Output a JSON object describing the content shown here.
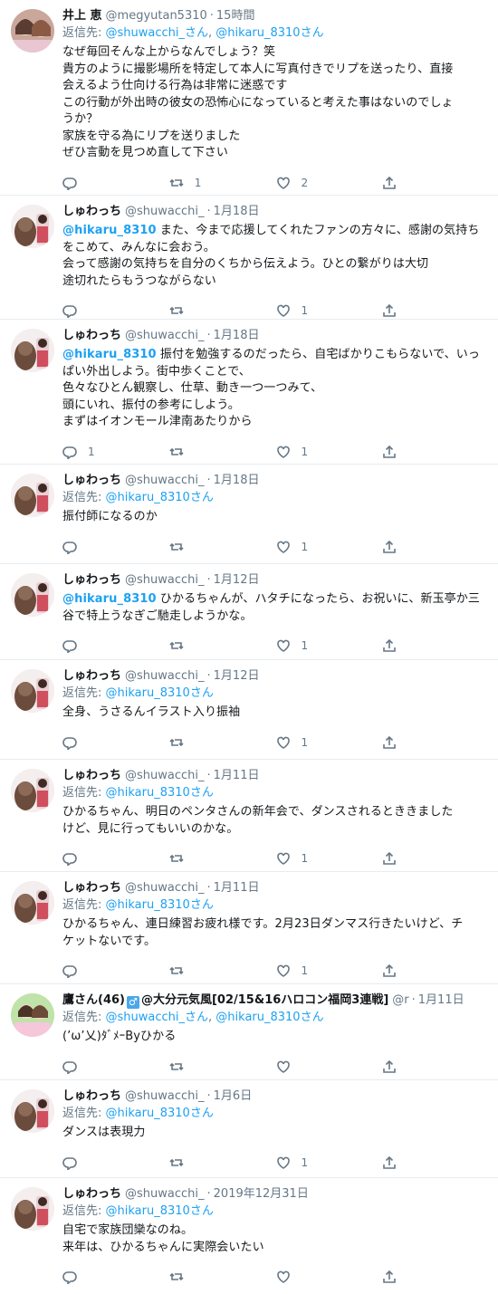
{
  "colors": {
    "link": "#1da1f2",
    "muted": "#657786",
    "border": "#e6ecf0"
  },
  "tweets": [
    {
      "name": "井上 恵",
      "handle": "@megyutan5310",
      "time": "15時間",
      "reply_label": "返信先:",
      "reply_to_1": "@shuwacchi_さん",
      "reply_sep": ", ",
      "reply_to_2": "@hikaru_8310さん",
      "mention": "",
      "text": "なぜ毎回そんな上からなんでしょう？笑\n貴方のように撮影場所を特定して本人に写真付きでリプを送ったり、直接\n会えるよう仕向ける行為は非常に迷惑です\nこの行動が外出時の彼女の恐怖心になっていると考えた事はないのでしょ\nうか？\n家族を守る為にリプを送りました\nぜひ言動を見つめ直して下さい",
      "reply_count": "",
      "retweet_count": "1",
      "like_count": "2"
    },
    {
      "name": "しゅわっち",
      "handle": "@shuwacchi_",
      "time": "1月18日",
      "mention": "@hikaru_8310",
      "text": " また、今まで応援してくれたファンの方々に、感謝の気持ち\nをこめて、みんなに会おう。\n会って感謝の気持ちを自分のくちから伝えよう。ひとの繋がりは大切\n途切れたらもうつながらない",
      "reply_count": "",
      "retweet_count": "",
      "like_count": "1"
    },
    {
      "name": "しゅわっち",
      "handle": "@shuwacchi_",
      "time": "1月18日",
      "mention": "@hikaru_8310",
      "text": " 振付を勉強するのだったら、自宅ばかりこもらないで、いっ\nぱい外出しよう。街中歩くことで、\n色々なひとん観察し、仕草、動き一つ一つみて、\n頭にいれ、振付の参考にしよう。\nまずはイオンモール津南あたりから",
      "reply_count": "1",
      "retweet_count": "",
      "like_count": "1"
    },
    {
      "name": "しゅわっち",
      "handle": "@shuwacchi_",
      "time": "1月18日",
      "reply_label": "返信先:",
      "reply_to_1": "@hikaru_8310さん",
      "mention": "",
      "text": "振付師になるのか",
      "reply_count": "",
      "retweet_count": "",
      "like_count": "1"
    },
    {
      "name": "しゅわっち",
      "handle": "@shuwacchi_",
      "time": "1月12日",
      "mention": "@hikaru_8310",
      "text": " ひかるちゃんが、ハタチになったら、お祝いに、新玉亭か三\n谷で特上うなぎご馳走しようかな。",
      "reply_count": "",
      "retweet_count": "",
      "like_count": "1"
    },
    {
      "name": "しゅわっち",
      "handle": "@shuwacchi_",
      "time": "1月12日",
      "reply_label": "返信先:",
      "reply_to_1": "@hikaru_8310さん",
      "mention": "",
      "text": "全身、うさるんイラスト入り振袖",
      "reply_count": "",
      "retweet_count": "",
      "like_count": "1"
    },
    {
      "name": "しゅわっち",
      "handle": "@shuwacchi_",
      "time": "1月11日",
      "reply_label": "返信先:",
      "reply_to_1": "@hikaru_8310さん",
      "mention": "",
      "text": "ひかるちゃん、明日のペンタさんの新年会で、ダンスされるとききました\nけど、見に行ってもいいのかな。",
      "reply_count": "",
      "retweet_count": "",
      "like_count": "1"
    },
    {
      "name": "しゅわっち",
      "handle": "@shuwacchi_",
      "time": "1月11日",
      "reply_label": "返信先:",
      "reply_to_1": "@hikaru_8310さん",
      "mention": "",
      "text": "ひかるちゃん、連日練習お疲れ様です。2月23日ダンマス行きたいけど、チ\nケットないです。",
      "reply_count": "",
      "retweet_count": "",
      "like_count": "1"
    },
    {
      "name_prefix": "鷹さん(46)",
      "name_flag": "♂",
      "name_suffix": "@大分元気風[02/15&16ハロコン福岡3連戦]",
      "handle": "@r",
      "time": "1月11日",
      "reply_label": "返信先:",
      "reply_to_1": "@shuwacchi_さん",
      "reply_sep": ", ",
      "reply_to_2": "@hikaru_8310さん",
      "mention": "",
      "text": "(’ω’乂)ﾀﾞﾒｰByひかる",
      "reply_count": "",
      "retweet_count": "",
      "like_count": ""
    },
    {
      "name": "しゅわっち",
      "handle": "@shuwacchi_",
      "time": "1月6日",
      "reply_label": "返信先:",
      "reply_to_1": "@hikaru_8310さん",
      "mention": "",
      "text": "ダンスは表現力",
      "reply_count": "",
      "retweet_count": "",
      "like_count": "1"
    },
    {
      "name": "しゅわっち",
      "handle": "@shuwacchi_",
      "time": "2019年12月31日",
      "reply_label": "返信先:",
      "reply_to_1": "@hikaru_8310さん",
      "mention": "",
      "text": "自宅で家族団欒なのね。\n来年は、ひかるちゃんに実際会いたい",
      "reply_count": "",
      "retweet_count": "",
      "like_count": ""
    }
  ]
}
